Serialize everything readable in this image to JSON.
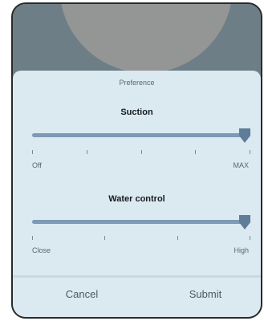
{
  "dialog": {
    "title": "Preference"
  },
  "suction": {
    "label": "Suction",
    "value_fraction": 1.0,
    "min_label": "Off",
    "max_label": "MAX",
    "tick_count": 5
  },
  "water": {
    "label": "Water control",
    "value_fraction": 1.0,
    "min_label": "Close",
    "max_label": "High",
    "tick_count": 4
  },
  "footer": {
    "cancel_label": "Cancel",
    "submit_label": "Submit"
  },
  "colors": {
    "sheet_bg": "#dbe9f1",
    "track": "#7d9ab6",
    "thumb": "#5f7c98"
  }
}
